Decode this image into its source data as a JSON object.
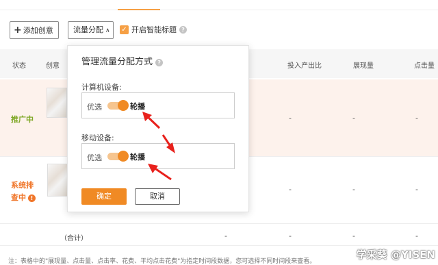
{
  "toolbar": {
    "add_label": "添加创意",
    "flow_label": "流量分配",
    "smart_title_label": "开启智能标题",
    "smart_title_checked": true
  },
  "table": {
    "headers": [
      "状态",
      "创意",
      "投入产出比",
      "展现量",
      "点击量"
    ],
    "rows": [
      {
        "status": "推广中",
        "status_color": "#7fa826",
        "values": [
          "-",
          "-",
          "-"
        ]
      },
      {
        "status": "系统排查中",
        "status_color": "#f0762a",
        "values": [
          "-",
          "-",
          "-"
        ]
      }
    ],
    "total_label": "（合计）",
    "total_values": [
      "-",
      "-",
      "-",
      "-"
    ]
  },
  "popover": {
    "title": "管理流量分配方式",
    "computer_label": "计算机设备:",
    "mobile_label": "移动设备:",
    "computer_option_left": "优选",
    "computer_option_right": "轮播",
    "mobile_option_left": "优选",
    "mobile_option_right": "轮播",
    "confirm_label": "确定",
    "cancel_label": "取消"
  },
  "footnote": "注：表格中的\"展现量、点击量、点击率、花费、平均点击花费\"为指定时间段数据，您可选择不同时间段来查看。",
  "watermark": "学采葵 @YISEN",
  "colors": {
    "accent": "#f08a24",
    "arrow": "#e8211c",
    "green": "#7fa826"
  }
}
